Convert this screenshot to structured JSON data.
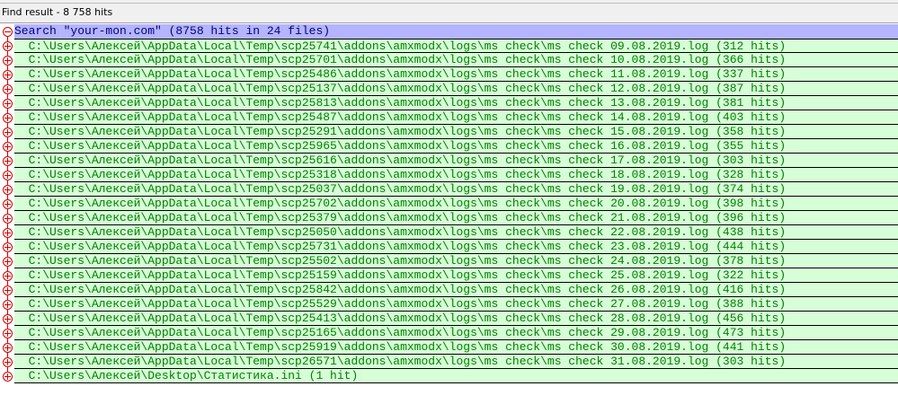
{
  "window": {
    "title": "Find result - 8 758 hits"
  },
  "search": {
    "header": "Search \"your-mon.com\" (8758 hits in 24 files)"
  },
  "files": [
    "C:\\Users\\Алексей\\AppData\\Local\\Temp\\scp25741\\addons\\amxmodx\\logs\\ms check\\ms check 09.08.2019.log (312 hits)",
    "C:\\Users\\Алексей\\AppData\\Local\\Temp\\scp25701\\addons\\amxmodx\\logs\\ms check\\ms check 10.08.2019.log (366 hits)",
    "C:\\Users\\Алексей\\AppData\\Local\\Temp\\scp25486\\addons\\amxmodx\\logs\\ms check\\ms check 11.08.2019.log (337 hits)",
    "C:\\Users\\Алексей\\AppData\\Local\\Temp\\scp25137\\addons\\amxmodx\\logs\\ms check\\ms check 12.08.2019.log (387 hits)",
    "C:\\Users\\Алексей\\AppData\\Local\\Temp\\scp25813\\addons\\amxmodx\\logs\\ms check\\ms check 13.08.2019.log (381 hits)",
    "C:\\Users\\Алексей\\AppData\\Local\\Temp\\scp25487\\addons\\amxmodx\\logs\\ms check\\ms check 14.08.2019.log (403 hits)",
    "C:\\Users\\Алексей\\AppData\\Local\\Temp\\scp25291\\addons\\amxmodx\\logs\\ms check\\ms check 15.08.2019.log (358 hits)",
    "C:\\Users\\Алексей\\AppData\\Local\\Temp\\scp25965\\addons\\amxmodx\\logs\\ms check\\ms check 16.08.2019.log (355 hits)",
    "C:\\Users\\Алексей\\AppData\\Local\\Temp\\scp25616\\addons\\amxmodx\\logs\\ms check\\ms check 17.08.2019.log (303 hits)",
    "C:\\Users\\Алексей\\AppData\\Local\\Temp\\scp25318\\addons\\amxmodx\\logs\\ms check\\ms check 18.08.2019.log (328 hits)",
    "C:\\Users\\Алексей\\AppData\\Local\\Temp\\scp25037\\addons\\amxmodx\\logs\\ms check\\ms check 19.08.2019.log (374 hits)",
    "C:\\Users\\Алексей\\AppData\\Local\\Temp\\scp25702\\addons\\amxmodx\\logs\\ms check\\ms check 20.08.2019.log (398 hits)",
    "C:\\Users\\Алексей\\AppData\\Local\\Temp\\scp25379\\addons\\amxmodx\\logs\\ms check\\ms check 21.08.2019.log (396 hits)",
    "C:\\Users\\Алексей\\AppData\\Local\\Temp\\scp25050\\addons\\amxmodx\\logs\\ms check\\ms check 22.08.2019.log (438 hits)",
    "C:\\Users\\Алексей\\AppData\\Local\\Temp\\scp25731\\addons\\amxmodx\\logs\\ms check\\ms check 23.08.2019.log (444 hits)",
    "C:\\Users\\Алексей\\AppData\\Local\\Temp\\scp25502\\addons\\amxmodx\\logs\\ms check\\ms check 24.08.2019.log (378 hits)",
    "C:\\Users\\Алексей\\AppData\\Local\\Temp\\scp25159\\addons\\amxmodx\\logs\\ms check\\ms check 25.08.2019.log (322 hits)",
    "C:\\Users\\Алексей\\AppData\\Local\\Temp\\scp25842\\addons\\amxmodx\\logs\\ms check\\ms check 26.08.2019.log (416 hits)",
    "C:\\Users\\Алексей\\AppData\\Local\\Temp\\scp25529\\addons\\amxmodx\\logs\\ms check\\ms check 27.08.2019.log (388 hits)",
    "C:\\Users\\Алексей\\AppData\\Local\\Temp\\scp25413\\addons\\amxmodx\\logs\\ms check\\ms check 28.08.2019.log (456 hits)",
    "C:\\Users\\Алексей\\AppData\\Local\\Temp\\scp25165\\addons\\amxmodx\\logs\\ms check\\ms check 29.08.2019.log (473 hits)",
    "C:\\Users\\Алексей\\AppData\\Local\\Temp\\scp25919\\addons\\amxmodx\\logs\\ms check\\ms check 30.08.2019.log (441 hits)",
    "C:\\Users\\Алексей\\AppData\\Local\\Temp\\scp26571\\addons\\amxmodx\\logs\\ms check\\ms check 31.08.2019.log (303 hits)",
    "C:\\Users\\Алексей\\Desktop\\Статистика.ini (1 hit)"
  ],
  "colors": {
    "header_bg": "#b4b4ff",
    "header_text": "#00007f",
    "file_bg": "#d7ffd7",
    "file_text": "#008000",
    "fold_marker": "#d20000"
  },
  "icons": {
    "fold": "fold-collapse-icon"
  }
}
